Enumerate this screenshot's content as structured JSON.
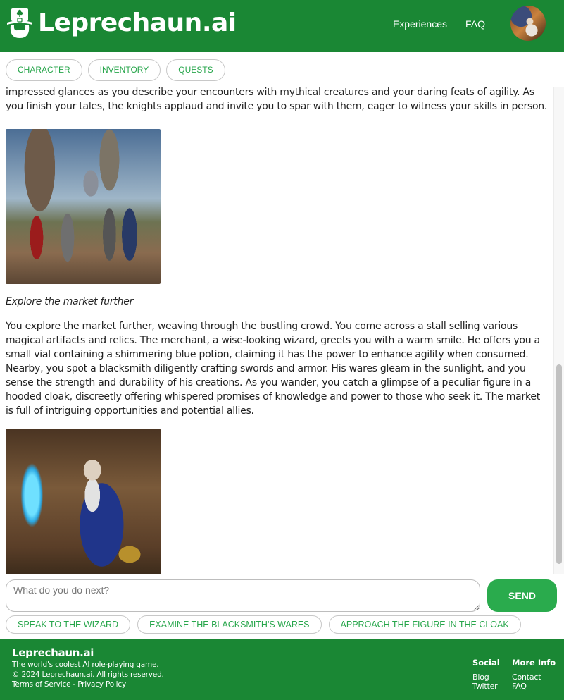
{
  "brand": {
    "name": "Leprechaun.ai",
    "logo_icon": "leprechaun-hat-beard-icon"
  },
  "header": {
    "nav": [
      "Experiences",
      "FAQ"
    ],
    "avatar_alt": "wizard-avatar"
  },
  "tabs": [
    "CHARACTER",
    "INVENTORY",
    "QUESTS"
  ],
  "story": {
    "paragraph_top": "impressed glances as you describe your encounters with mythical creatures and your daring feats of agility. As you finish your tales, the knights applaud and invite you to spar with them, eager to witness your skills in person.",
    "image_1": "knights-sparring-illustration",
    "action_caption": "Explore the market further",
    "paragraph_main": "You explore the market further, weaving through the bustling crowd. You come across a stall selling various magical artifacts and relics. The merchant, a wise-looking wizard, greets you with a warm smile. He offers you a small vial containing a shimmering blue potion, claiming it has the power to enhance agility when consumed. Nearby, you spot a blacksmith diligently crafting swords and armor. His wares gleam in the sunlight, and you sense the strength and durability of his creations. As you wander, you catch a glimpse of a peculiar figure in a hooded cloak, discreetly offering whispered promises of knowledge and power to those who seek it. The market is full of intriguing opportunities and potential allies.",
    "image_2": "wizard-merchant-illustration",
    "scroll": {
      "thumb_start_fraction": 0.57,
      "thumb_size_fraction": 0.41
    }
  },
  "input": {
    "placeholder": "What do you do next?",
    "value": "",
    "send_label": "SEND"
  },
  "suggestions": [
    "SPEAK TO THE WIZARD",
    "EXAMINE THE BLACKSMITH'S WARES",
    "APPROACH THE FIGURE IN THE CLOAK"
  ],
  "footer": {
    "title": "Leprechaun.ai",
    "tagline": "The world's coolest AI role-playing game.",
    "copyright": "© 2024 Leprechaun.ai. All rights reserved.",
    "terms": "Terms of Service",
    "separator": " - ",
    "privacy": "Privacy Policy",
    "social": {
      "heading": "Social",
      "links": [
        "Blog",
        "Twitter"
      ]
    },
    "more_info": {
      "heading": "More Info",
      "links": [
        "Contact",
        "FAQ"
      ]
    }
  },
  "colors": {
    "brand_green": "#1a8734",
    "accent_green": "#2aab4d",
    "pill_text_green": "#27a64b"
  }
}
